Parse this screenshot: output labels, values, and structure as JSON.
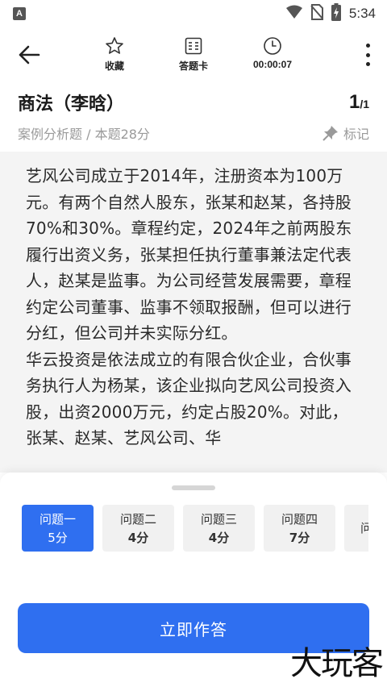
{
  "status": {
    "time": "5:34",
    "app_icon_letter": "A",
    "icons": [
      "wifi-icon",
      "no-sim-icon",
      "battery-charging-icon"
    ]
  },
  "toolbar": {
    "back_icon": "arrow-left-icon",
    "favorite_label": "收藏",
    "answer_card_label": "答题卡",
    "timer_label": "00:00:07",
    "more_icon": "more-vertical-icon"
  },
  "question": {
    "title": "商法（李晗）",
    "current": "1",
    "total": "/1",
    "subtitle": "案例分析题 / 本题28分",
    "mark_label": "标记"
  },
  "content": {
    "paragraphs": [
      "艺风公司成立于2014年，注册资本为100万元。有两个自然人股东，张某和赵某，各持股70%和30%。章程约定，2024年之前两股东履行出资义务，张某担任执行董事兼法定代表人，赵某是监事。为公司经营发展需要，章程约定公司董事、监事不领取报酬，但可以进行分红，但公司并未实际分红。",
      "华云投资是依法成立的有限合伙企业，合伙事务执行人为杨某，该企业拟向艺风公司投资入股，出资2000万元，约定占股20%。对此，张某、赵某、艺风公司、华"
    ]
  },
  "sub_questions": [
    {
      "name": "问题一",
      "score": "5分",
      "active": true
    },
    {
      "name": "问题二",
      "score": "4分",
      "active": false
    },
    {
      "name": "问题三",
      "score": "4分",
      "active": false
    },
    {
      "name": "问题四",
      "score": "7分",
      "active": false
    },
    {
      "name": "问",
      "score": "",
      "active": false
    }
  ],
  "actions": {
    "answer_now": "立即作答"
  },
  "watermark": "大玩客",
  "colors": {
    "accent": "#2f6ff0",
    "content_bg": "#f4f4f4",
    "muted_text": "#9a9a9a"
  }
}
